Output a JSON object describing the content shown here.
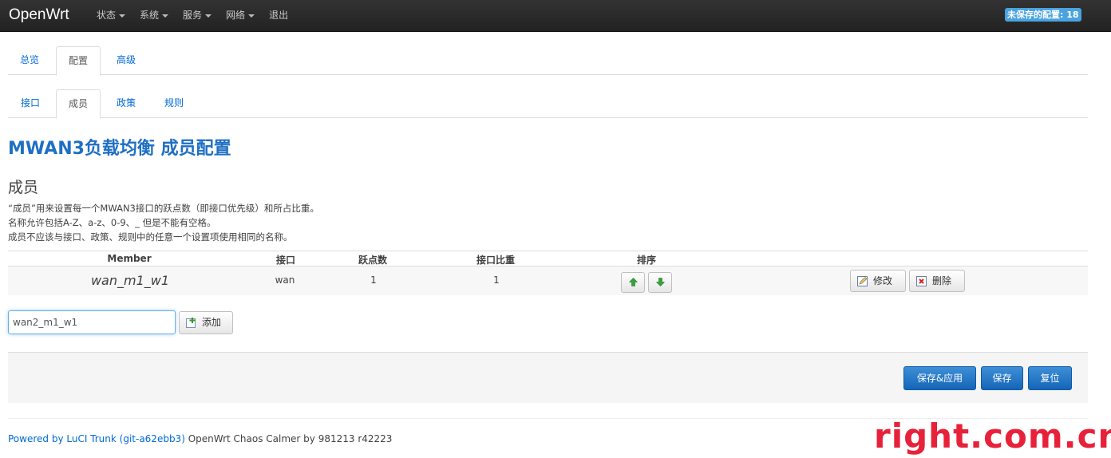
{
  "navbar": {
    "brand": "OpenWrt",
    "menu": [
      {
        "label": "状态",
        "dropdown": true
      },
      {
        "label": "系统",
        "dropdown": true
      },
      {
        "label": "服务",
        "dropdown": true
      },
      {
        "label": "网络",
        "dropdown": true
      },
      {
        "label": "退出",
        "dropdown": false
      }
    ],
    "unsaved_badge": "未保存的配置: 18"
  },
  "tabs_main": [
    "总览",
    "配置",
    "高级"
  ],
  "tabs_main_active": "配置",
  "tabs_sub": [
    "接口",
    "成员",
    "政策",
    "规则"
  ],
  "tabs_sub_active": "成员",
  "page_title": "MWAN3负载均衡 成员配置",
  "section": {
    "title": "成员",
    "description": [
      "“成员”用来设置每一个MWAN3接口的跃点数（即接口优先级）和所占比重。",
      "名称允许包括A-Z、a-z、0-9、_ 但是不能有空格。",
      "成员不应该与接口、政策、规则中的任意一个设置项使用相同的名称。"
    ]
  },
  "table": {
    "headers": [
      "Member",
      "接口",
      "跃点数",
      "接口比重",
      "排序"
    ],
    "rows": [
      {
        "name": "wan_m1_w1",
        "interface": "wan",
        "metric": "1",
        "weight": "1"
      }
    ],
    "edit_label": "修改",
    "delete_label": "删除",
    "sort_up_icon": "arrow-up-icon",
    "sort_down_icon": "arrow-down-icon"
  },
  "add": {
    "input_value": "wan2_m1_w1",
    "button_label": "添加"
  },
  "actions": {
    "save_apply": "保存&应用",
    "save": "保存",
    "reset": "复位"
  },
  "footer": {
    "link_text": "Powered by LuCI Trunk (git-a62ebb3)",
    "text": " OpenWrt Chaos Calmer by 981213 r42223"
  },
  "watermark": "right.com.cn",
  "colors": {
    "navbar": "#222222",
    "link": "#0069d6",
    "title": "#1f6fc4",
    "badge": "#4aa3df",
    "primary_button": "#1565b8",
    "watermark": "#e8213a"
  }
}
